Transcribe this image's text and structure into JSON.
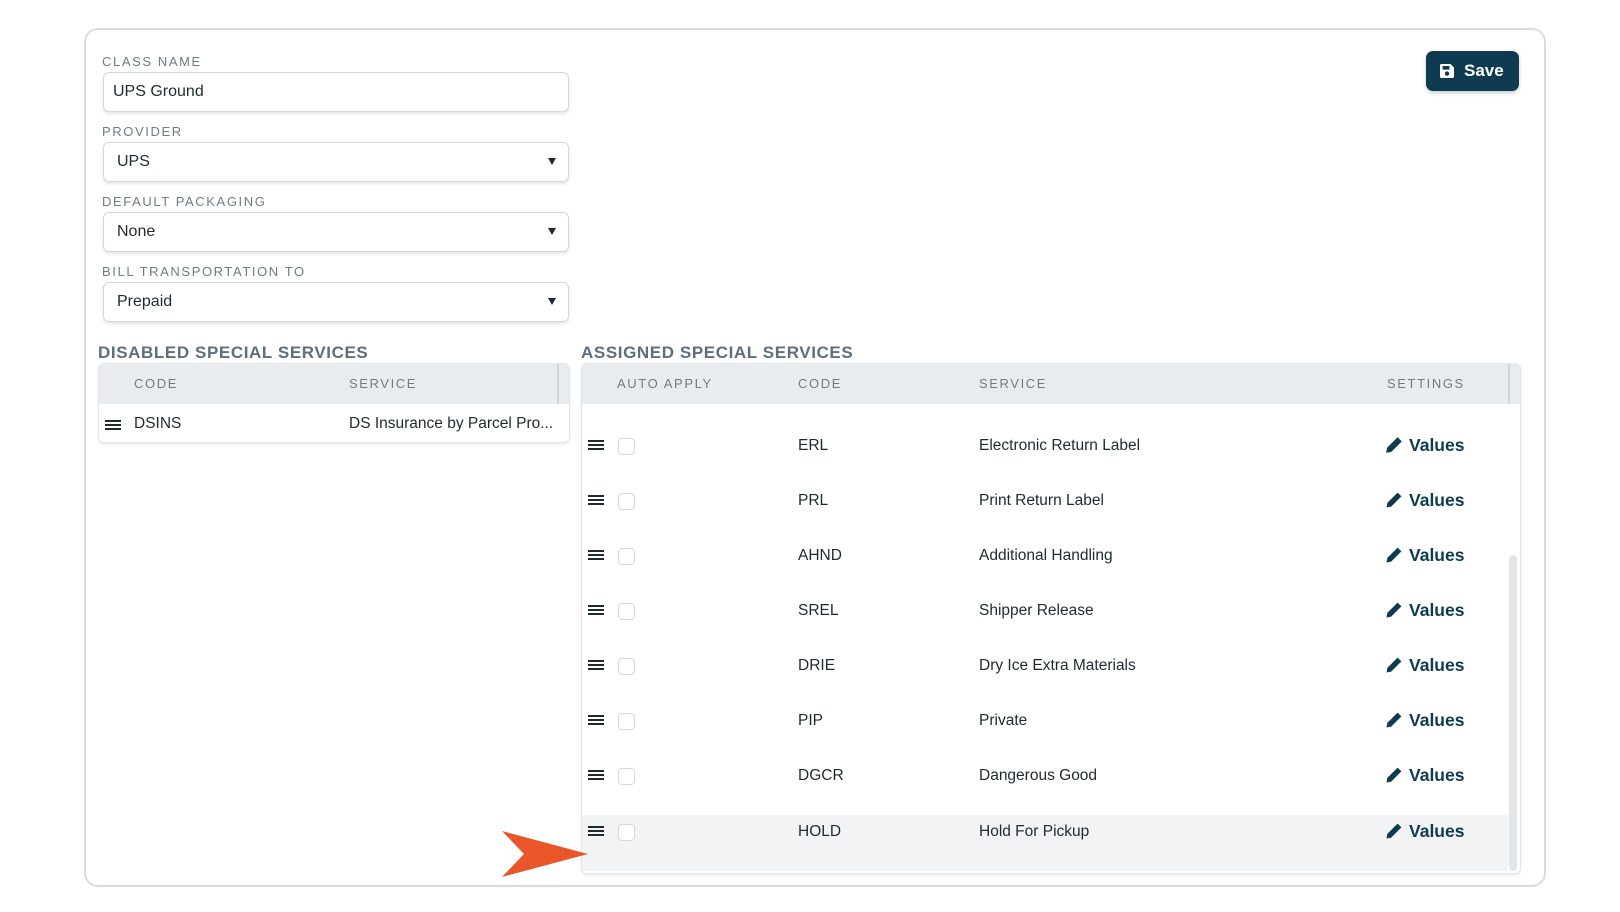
{
  "form": {
    "class_name": {
      "label": "CLASS NAME",
      "value": "UPS Ground"
    },
    "provider": {
      "label": "PROVIDER",
      "value": "UPS"
    },
    "default_packaging": {
      "label": "DEFAULT PACKAGING",
      "value": "None"
    },
    "bill_transportation": {
      "label": "BILL TRANSPORTATION TO",
      "value": "Prepaid"
    }
  },
  "toolbar": {
    "save_label": "Save",
    "save_icon": "floppy-disk-icon"
  },
  "disabled_services": {
    "title": "DISABLED SPECIAL SERVICES",
    "columns": [
      "CODE",
      "SERVICE"
    ],
    "rows": [
      {
        "code": "DSINS",
        "service": "DS Insurance by Parcel Pro..."
      }
    ]
  },
  "assigned_services": {
    "title": "ASSIGNED SPECIAL SERVICES",
    "columns": [
      "AUTO APPLY",
      "CODE",
      "SERVICE",
      "SETTINGS"
    ],
    "values_label": "Values",
    "rows": [
      {
        "code": "ERL",
        "service": "Electronic Return Label",
        "auto_apply": false
      },
      {
        "code": "PRL",
        "service": "Print Return Label",
        "auto_apply": false
      },
      {
        "code": "AHND",
        "service": "Additional Handling",
        "auto_apply": false
      },
      {
        "code": "SREL",
        "service": "Shipper Release",
        "auto_apply": false
      },
      {
        "code": "DRIE",
        "service": "Dry Ice Extra Materials",
        "auto_apply": false
      },
      {
        "code": "PIP",
        "service": "Private",
        "auto_apply": false
      },
      {
        "code": "DGCR",
        "service": "Dangerous Good",
        "auto_apply": false
      },
      {
        "code": "HOLD",
        "service": "Hold For Pickup",
        "auto_apply": false
      }
    ]
  },
  "colors": {
    "brand": "#0f3b50",
    "annotation_arrow": "#e8562a",
    "section_title": "#5d6f7e"
  }
}
